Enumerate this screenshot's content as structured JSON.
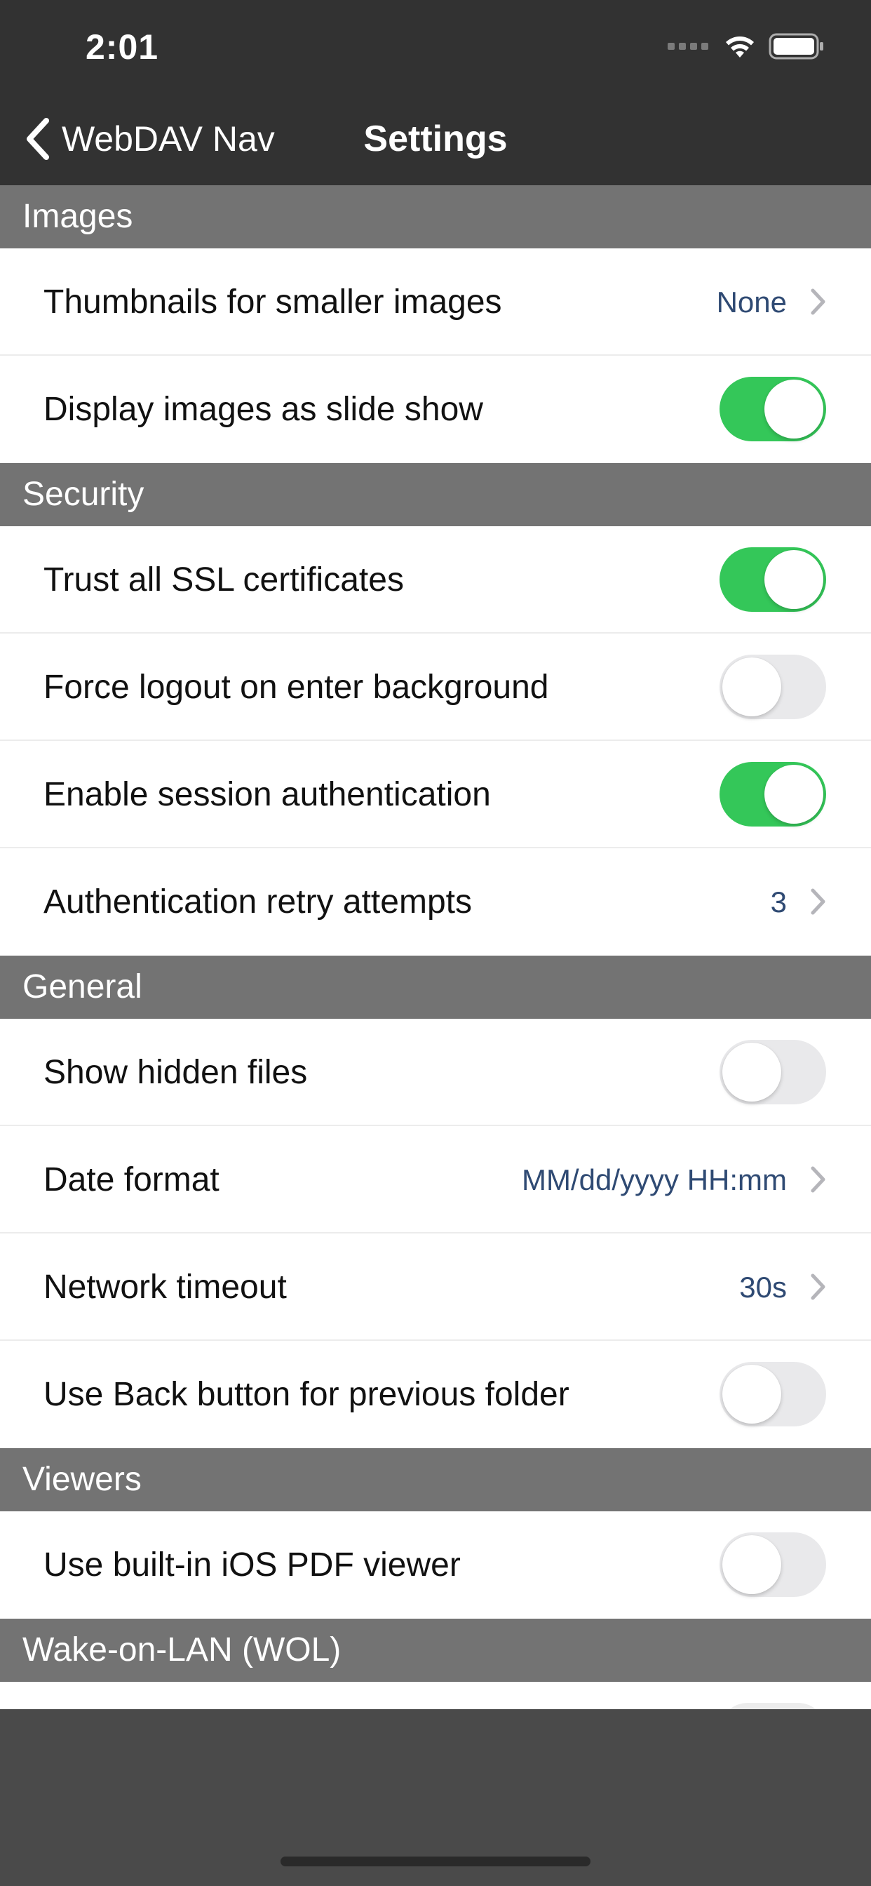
{
  "status_bar": {
    "time": "2:01"
  },
  "nav": {
    "back_label": "WebDAV Nav",
    "title": "Settings"
  },
  "sections": {
    "images": {
      "header": "Images",
      "thumbnails": {
        "label": "Thumbnails for smaller images",
        "value": "None"
      },
      "slide_show": {
        "label": "Display images as slide show",
        "on": true
      }
    },
    "security": {
      "header": "Security",
      "trust_ssl": {
        "label": "Trust all SSL certificates",
        "on": true
      },
      "force_logout": {
        "label": "Force logout on enter background",
        "on": false
      },
      "session_auth": {
        "label": "Enable session authentication",
        "on": true
      },
      "retry_attempts": {
        "label": "Authentication retry attempts",
        "value": "3"
      }
    },
    "general": {
      "header": "General",
      "show_hidden": {
        "label": "Show hidden files",
        "on": false
      },
      "date_format": {
        "label": "Date format",
        "value": "MM/dd/yyyy HH:mm"
      },
      "network_timeout": {
        "label": "Network timeout",
        "value": "30s"
      },
      "back_button": {
        "label": "Use Back button for previous folder",
        "on": false
      }
    },
    "viewers": {
      "header": "Viewers",
      "pdf_viewer": {
        "label": "Use built-in iOS PDF viewer",
        "on": false
      }
    },
    "wol": {
      "header": "Wake-on-LAN (WOL)"
    }
  },
  "colors": {
    "toggle_on": "#34c759",
    "toggle_off": "#e9e9eb",
    "value_text": "#2f4a73",
    "section_header": "#737373",
    "nav_background": "#323232"
  },
  "icons": {
    "back": "chevron-left-icon",
    "disclosure": "chevron-right-icon",
    "wifi": "wifi-icon",
    "battery": "battery-icon",
    "signal": "cellular-signal-icon"
  }
}
